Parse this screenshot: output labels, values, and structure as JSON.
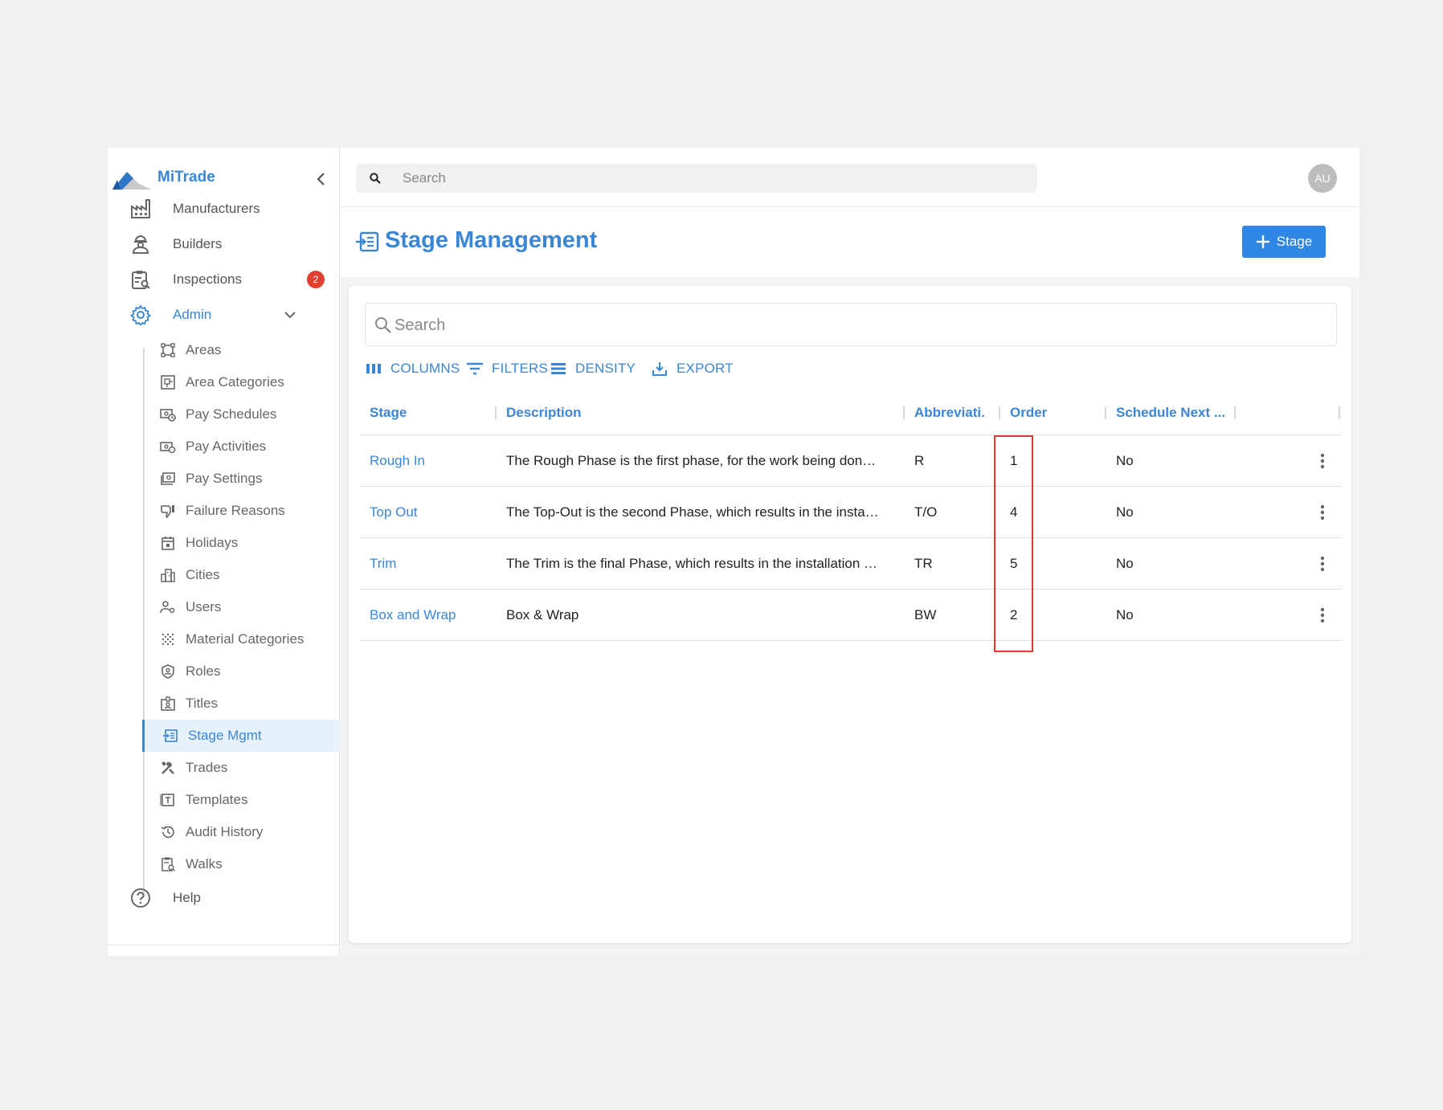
{
  "brand": {
    "name": "MiTrade"
  },
  "topbar": {
    "search_placeholder": "Search",
    "avatar_initials": "AU"
  },
  "sidebar": {
    "items": [
      {
        "label": "Manufacturers",
        "icon": "factory-icon"
      },
      {
        "label": "Builders",
        "icon": "worker-icon"
      },
      {
        "label": "Inspections",
        "icon": "clipboard-search-icon",
        "badge": "2"
      },
      {
        "label": "Admin",
        "icon": "gear-icon"
      }
    ],
    "admin_items": [
      {
        "label": "Areas",
        "icon": "area-icon"
      },
      {
        "label": "Area Categories",
        "icon": "area-categories-icon"
      },
      {
        "label": "Pay Schedules",
        "icon": "pay-schedules-icon"
      },
      {
        "label": "Pay Activities",
        "icon": "pay-activities-icon"
      },
      {
        "label": "Pay Settings",
        "icon": "pay-settings-icon"
      },
      {
        "label": "Failure Reasons",
        "icon": "thumbs-down-icon"
      },
      {
        "label": "Holidays",
        "icon": "calendar-icon"
      },
      {
        "label": "Cities",
        "icon": "city-icon"
      },
      {
        "label": "Users",
        "icon": "users-icon"
      },
      {
        "label": "Material Categories",
        "icon": "grid-dots-icon"
      },
      {
        "label": "Roles",
        "icon": "shield-user-icon"
      },
      {
        "label": "Titles",
        "icon": "badge-icon"
      },
      {
        "label": "Stage Mgmt",
        "icon": "stage-icon",
        "active": true
      },
      {
        "label": "Trades",
        "icon": "tools-icon"
      },
      {
        "label": "Templates",
        "icon": "template-icon"
      },
      {
        "label": "Audit History",
        "icon": "history-icon"
      },
      {
        "label": "Walks",
        "icon": "clipboard-search-icon"
      }
    ],
    "help": {
      "label": "Help",
      "icon": "help-circle-icon"
    }
  },
  "page": {
    "title": "Stage Management",
    "add_button_label": "Stage"
  },
  "grid": {
    "search_placeholder": "Search",
    "toolbar": {
      "columns": "COLUMNS",
      "filters": "FILTERS",
      "density": "DENSITY",
      "export": "EXPORT"
    },
    "columns": [
      "Stage",
      "Description",
      "Abbreviati.",
      "Order",
      "Schedule Next ..."
    ],
    "rows": [
      {
        "stage": "Rough In",
        "description": "The Rough Phase is the first phase, for the work being don…",
        "abbreviation": "R",
        "order": "1",
        "schedule_next": "No"
      },
      {
        "stage": "Top Out",
        "description": "The Top-Out is the second Phase, which results in the insta…",
        "abbreviation": "T/O",
        "order": "4",
        "schedule_next": "No"
      },
      {
        "stage": "Trim",
        "description": "The Trim is the final Phase, which results in the installation …",
        "abbreviation": "TR",
        "order": "5",
        "schedule_next": "No"
      },
      {
        "stage": "Box and Wrap",
        "description": "Box & Wrap",
        "abbreviation": "BW",
        "order": "2",
        "schedule_next": "No"
      }
    ]
  },
  "colors": {
    "accent": "#3a86d6",
    "button": "#2f86e3",
    "badge": "#e0402f",
    "highlight": "#e03a2f"
  }
}
